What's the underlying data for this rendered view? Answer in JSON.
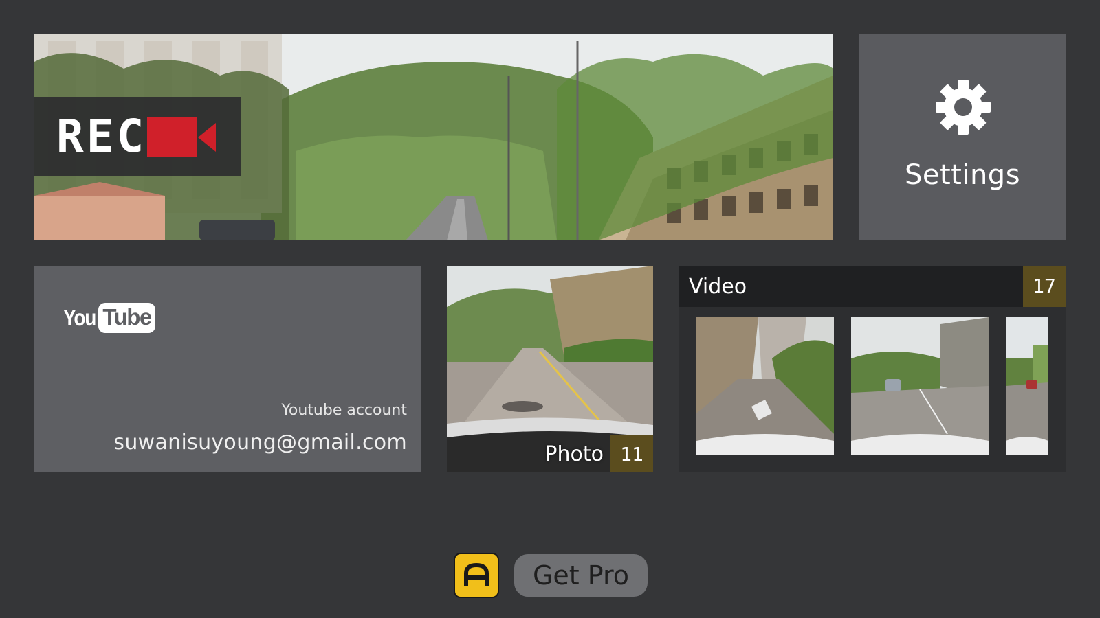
{
  "camera": {
    "rec_label": "REC",
    "rec_icon": "video-camera-icon",
    "rec_icon_color": "#d0202a"
  },
  "settings": {
    "label": "Settings",
    "icon": "gear-icon"
  },
  "youtube": {
    "logo_you": "You",
    "logo_tube": "Tube",
    "caption": "Youtube account",
    "email": "suwanisuyoung@gmail.com"
  },
  "photo": {
    "label": "Photo",
    "count": "11"
  },
  "video": {
    "label": "Video",
    "count": "17",
    "thumbnails": [
      "video-thumbnail-1",
      "video-thumbnail-2",
      "video-thumbnail-3"
    ]
  },
  "footer": {
    "app_icon": "app-logo-icon",
    "get_pro_label": "Get Pro"
  },
  "colors": {
    "background": "#353638",
    "tile_gray": "#5a5b5f",
    "badge": "#5b4d1e",
    "app_icon_yellow": "#f1bf1a"
  }
}
